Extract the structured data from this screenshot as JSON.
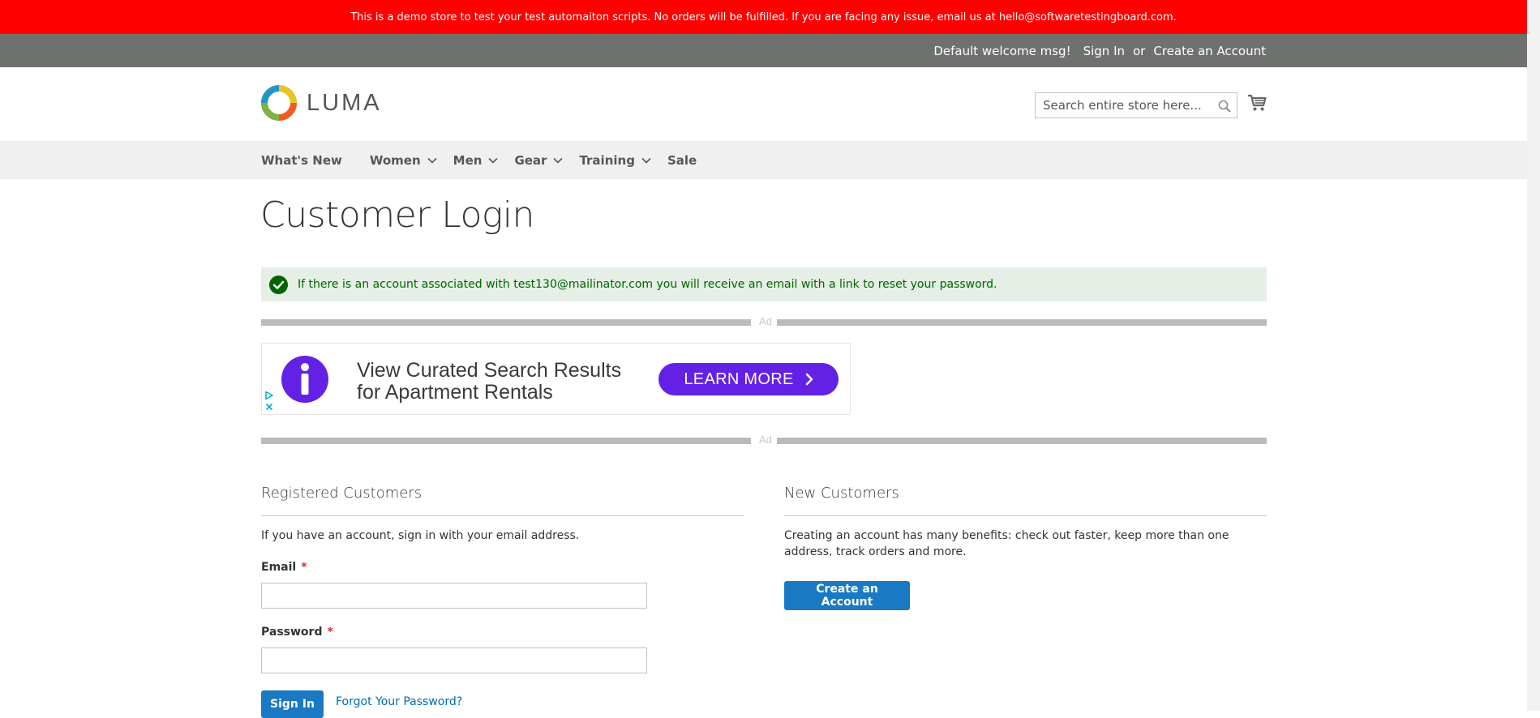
{
  "demo_banner": {
    "text": "This is a demo store to test your test automaiton scripts. No orders will be fulfilled. If you are facing any issue, email us at hello@softwaretestingboard.com."
  },
  "header": {
    "welcome": "Default welcome msg!",
    "sign_in": "Sign In",
    "or": "or",
    "create_account": "Create an Account"
  },
  "logo": {
    "text": "LUMA"
  },
  "search": {
    "placeholder": "Search entire store here...",
    "value": ""
  },
  "nav": {
    "items": [
      {
        "label": "What's New",
        "has_submenu": false
      },
      {
        "label": "Women",
        "has_submenu": true
      },
      {
        "label": "Men",
        "has_submenu": true
      },
      {
        "label": "Gear",
        "has_submenu": true
      },
      {
        "label": "Training",
        "has_submenu": true
      },
      {
        "label": "Sale",
        "has_submenu": false
      }
    ]
  },
  "page": {
    "title": "Customer Login"
  },
  "message": {
    "type": "success",
    "text": "If there is an account associated with test130@mailinator.com you will receive an email with a link to reset your password."
  },
  "ad": {
    "label": "Ad",
    "line1": "View Curated Search Results",
    "line2": "for Apartment Rentals",
    "cta": "LEARN MORE"
  },
  "registered": {
    "title": "Registered Customers",
    "intro": "If you have an account, sign in with your email address.",
    "email_label": "Email",
    "email_value": "",
    "password_label": "Password",
    "password_value": "",
    "required_mark": "*",
    "sign_in_button": "Sign In",
    "forgot_link": "Forgot Your Password?"
  },
  "new_customers": {
    "title": "New Customers",
    "intro": "Creating an account has many benefits: check out faster, keep more than one address, track orders and more.",
    "create_button": "Create an Account"
  },
  "colors": {
    "banner_bg": "#ff0000",
    "header_bg": "#6e716e",
    "nav_bg": "#f0f0f0",
    "success_bg": "#e5efe5",
    "success_text": "#006400",
    "primary_button": "#1979c3",
    "link": "#006bb4",
    "ad_cta": "#6421e6"
  },
  "icons": {
    "search": "search-icon",
    "cart": "cart-icon",
    "success": "check-circle-icon",
    "ad_info": "info-icon"
  }
}
